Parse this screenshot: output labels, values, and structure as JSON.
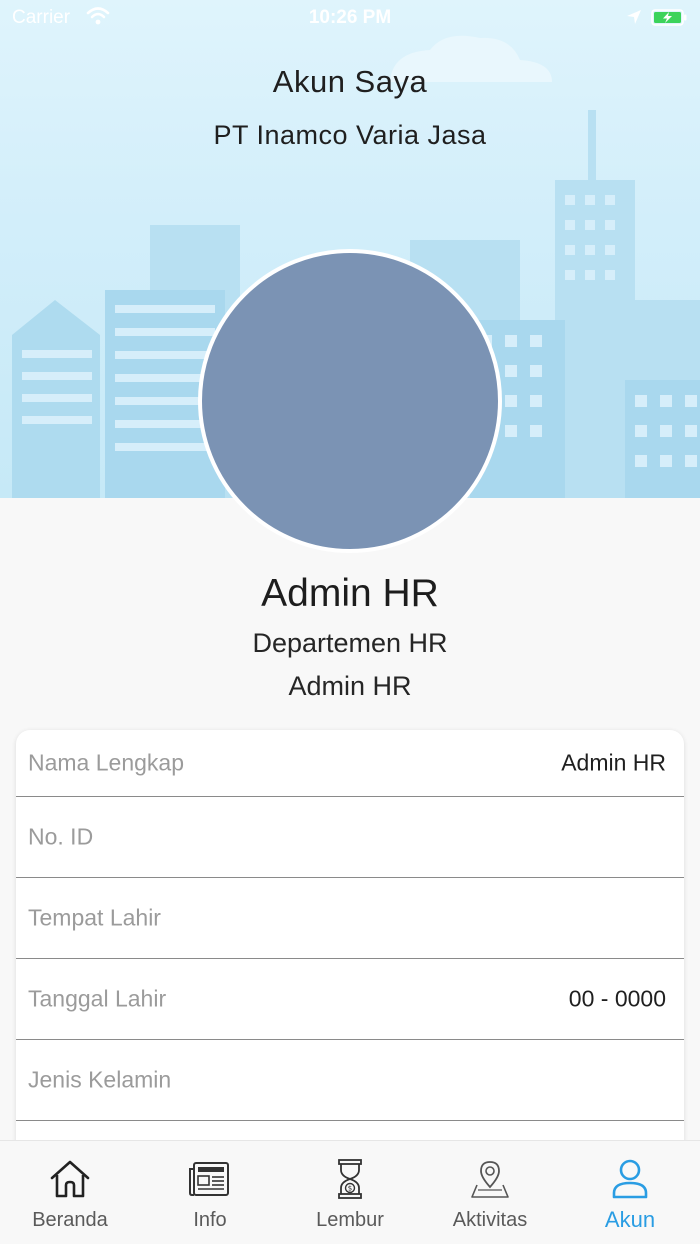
{
  "status_bar": {
    "carrier": "Carrier",
    "time": "10:26 PM"
  },
  "header": {
    "title": "Akun Saya",
    "company": "PT Inamco Varia Jasa"
  },
  "profile": {
    "name": "Admin HR",
    "department": "Departemen HR",
    "role": "Admin HR"
  },
  "details": [
    {
      "label": "Nama Lengkap",
      "value": "Admin HR"
    },
    {
      "label": "No. ID",
      "value": ""
    },
    {
      "label": "Tempat Lahir",
      "value": ""
    },
    {
      "label": "Tanggal Lahir",
      "value": "00 - 0000"
    },
    {
      "label": "Jenis Kelamin",
      "value": ""
    },
    {
      "label": "",
      "value": ""
    }
  ],
  "tabs": [
    {
      "label": "Beranda",
      "icon": "home-icon"
    },
    {
      "label": "Info",
      "icon": "newspaper-icon"
    },
    {
      "label": "Lembur",
      "icon": "hourglass-icon"
    },
    {
      "label": "Aktivitas",
      "icon": "location-map-icon"
    },
    {
      "label": "Akun",
      "icon": "user-icon",
      "active": true
    }
  ],
  "colors": {
    "accent": "#2a9de3",
    "avatar": "#7b93b4",
    "sky": "#d2eefa"
  }
}
